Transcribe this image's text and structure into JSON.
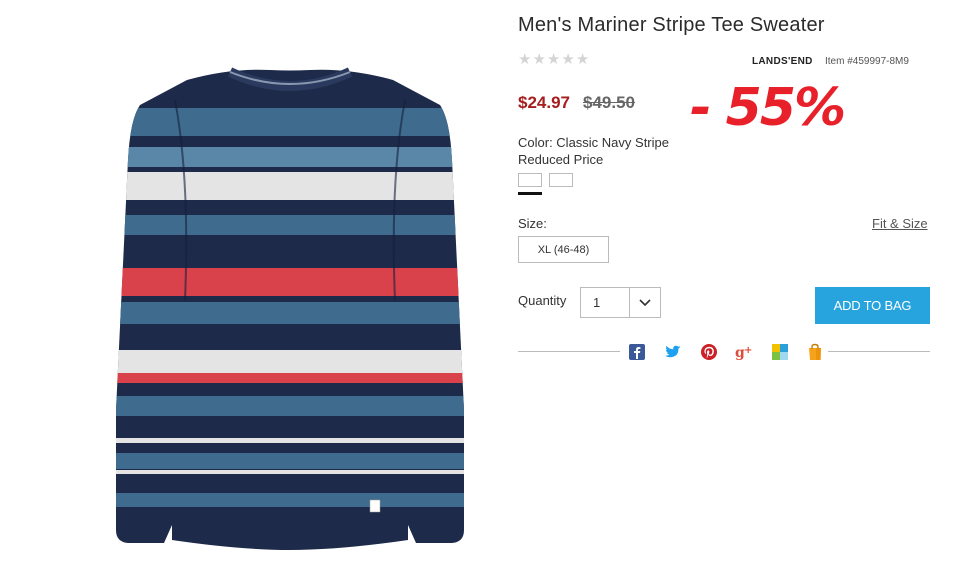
{
  "product": {
    "title": "Men's Mariner Stripe Tee Sweater",
    "rating_stars": 5,
    "brand": "LANDS'END",
    "item_number": "Item #459997-8M9",
    "sale_price": "$24.97",
    "original_price": "$49.50",
    "discount_badge": "- 55%",
    "color_label": "Color: Classic Navy Stripe",
    "price_note": "Reduced Price",
    "swatches": [
      "swatch-1",
      "swatch-2"
    ],
    "size_label": "Size:",
    "fit_link": "Fit & Size",
    "size_option": "XL (46-48)",
    "quantity_label": "Quantity",
    "quantity_value": "1",
    "add_to_bag": "ADD TO BAG"
  },
  "share": {
    "icons": [
      "facebook-icon",
      "twitter-icon",
      "pinterest-icon",
      "google-plus-icon",
      "polyvore-icon",
      "shopping-bag-icon"
    ]
  },
  "colors": {
    "sale_price": "#a61d1d",
    "discount": "#e8202a",
    "add_button": "#27a3dd",
    "facebook": "#3b5998",
    "twitter": "#1da1f2",
    "pinterest": "#cb2027",
    "google_plus": "#dd4b39",
    "navy": "#1d2a4a",
    "blue_stripe": "#3f6c8e",
    "red_stripe": "#d9424b",
    "white_stripe": "#e4e4e4"
  }
}
